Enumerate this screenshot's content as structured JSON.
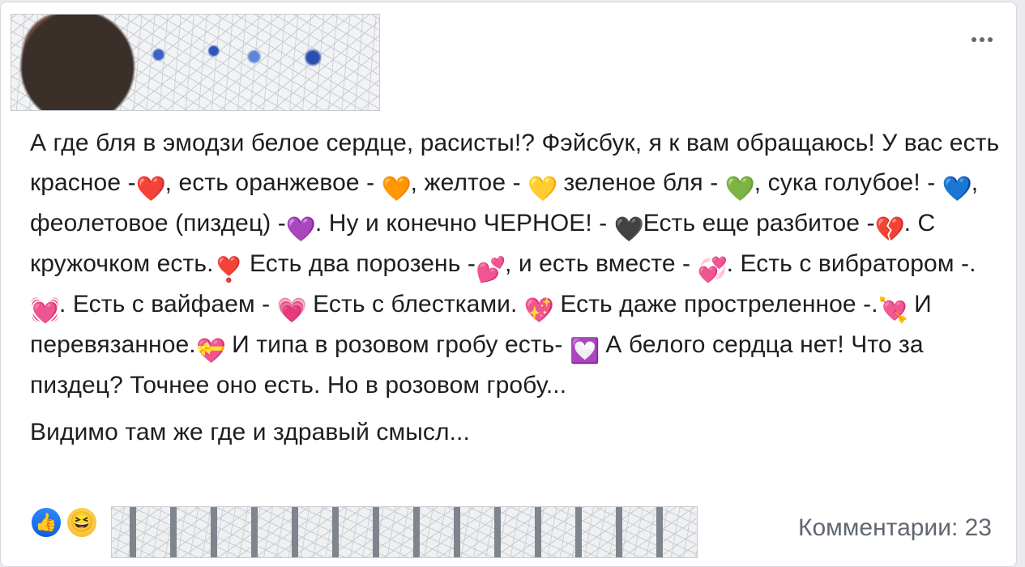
{
  "post": {
    "text": {
      "s1": "А где бля в эмодзи белое сердце, расисты!? Фэйсбук, я к вам обращаюсь! У вас есть красное -",
      "e1": "❤️",
      "s2": ", есть оранжевое - ",
      "e2": "🧡",
      "s3": ", желтое - ",
      "e3": "💛",
      "s4": " зеленое бля - ",
      "e4": "💚",
      "s5": ", сука голубое! - ",
      "e5": "💙",
      "s6": ", феолетовое (пиздец) -",
      "e6": "💜",
      "s7": ". Ну и конечно ЧЕРНОЕ! - ",
      "e7": "🖤",
      "s8": "Есть еще разбитое -",
      "e8": "💔",
      "s9": ". С кружочком есть.",
      "e9": "❣️",
      "s10": " Есть два порозень -",
      "e10": "💕",
      "s11": ", и есть вместе - ",
      "e11": "💞",
      "s12": ". Есть с вибратором -.",
      "e12": "💓",
      "s13": ". Есть с вайфаем - ",
      "e13": "💗",
      "s14": " Есть с блестками. ",
      "e14": "💖",
      "s15": " Есть даже простреленное -.",
      "e15": "💘",
      "s16": " И перевязанное.",
      "e16": "💝",
      "s17": " И типа в розовом гробу есть- ",
      "e17": "💟",
      "s18": " А белого сердца нет! Что за пиздец? Точнее оно есть. Но в розовом гробу...",
      "para2": "Видимо там же где и здравый смысл..."
    }
  },
  "footer": {
    "reactions": [
      "like-icon",
      "haha-icon"
    ],
    "reaction_like_glyph": "👍",
    "reaction_haha_glyph": "😆",
    "comments_label": "Комментарии: 23"
  },
  "colors": {
    "text": "#1c1e21",
    "secondary": "#606770",
    "like_blue": "#1877f2"
  }
}
